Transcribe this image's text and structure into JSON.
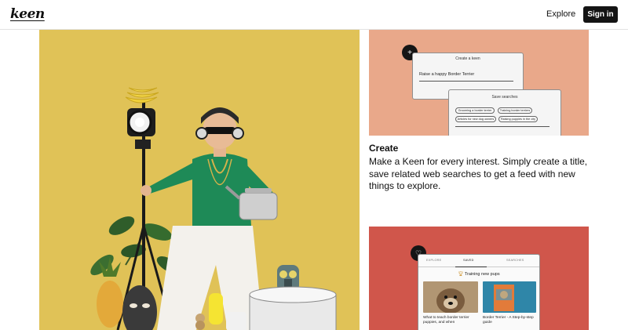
{
  "header": {
    "logo": "keen",
    "explore": "Explore",
    "signin": "Sign in"
  },
  "card1": {
    "badge": "+",
    "panel_title": "Create a keen",
    "field": "Raise a happy Border Terrier",
    "search_panel_title": "Save searches",
    "chips": [
      "Grooming a border terrier",
      "Training border terriers",
      "Articles for new dog owners",
      "Raising puppies in the city"
    ]
  },
  "create": {
    "title": "Create",
    "description": "Make a Keen for every interest. Simply create a title, save related web searches to get a feed with new things to explore."
  },
  "card2": {
    "tabs": [
      "EXPLORE",
      "SAVED",
      "SEARCHES"
    ],
    "section": "Training new pups",
    "captions": [
      "What to teach border terrier puppies, and when",
      "Border Terrier - A Step-by-step guide"
    ]
  },
  "colors": {
    "hero_bg": "#e0c257",
    "card1_bg": "#e9a88a",
    "card2_bg": "#d0564b",
    "signin_bg": "#141414"
  }
}
